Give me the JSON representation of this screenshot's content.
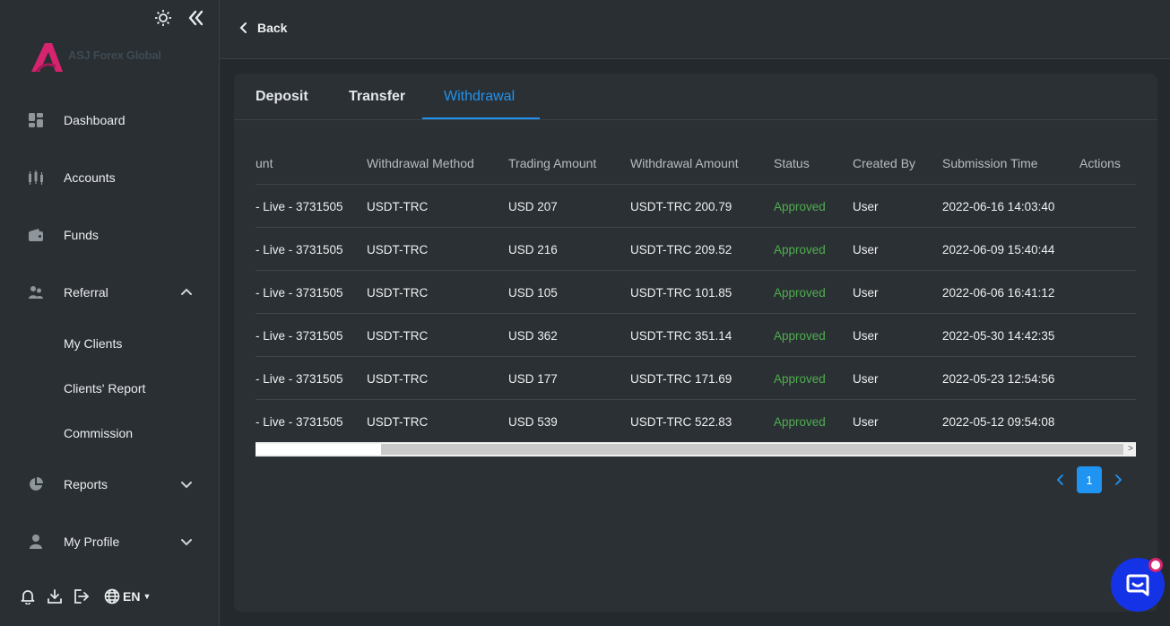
{
  "brand": {
    "name": "ASJ Forex Global",
    "accent": "#1f94f2",
    "logo_color": "#d6246e"
  },
  "sidebar": {
    "top_icons": [
      "sun-icon",
      "collapse-icon"
    ],
    "items": [
      {
        "label": "Dashboard",
        "icon": "dashboard-icon"
      },
      {
        "label": "Accounts",
        "icon": "accounts-icon"
      },
      {
        "label": "Funds",
        "icon": "wallet-icon"
      },
      {
        "label": "Referral",
        "icon": "users-icon",
        "expanded": true
      },
      {
        "label": "Reports",
        "icon": "pie-chart-icon",
        "expanded": false
      },
      {
        "label": "My Profile",
        "icon": "user-icon",
        "expanded": false
      }
    ],
    "referral_sub": [
      "My Clients",
      "Clients' Report",
      "Commission"
    ],
    "bottom_icons": [
      "bell-icon",
      "download-icon",
      "logout-icon",
      "globe-icon"
    ],
    "language": "EN"
  },
  "header": {
    "back_label": "Back"
  },
  "tabs": [
    {
      "label": "Deposit",
      "active": false
    },
    {
      "label": "Transfer",
      "active": false
    },
    {
      "label": "Withdrawal",
      "active": true
    }
  ],
  "table": {
    "columns": [
      "unt",
      "Withdrawal Method",
      "Trading Amount",
      "Withdrawal Amount",
      "Status",
      "Created By",
      "Submission Time",
      "Actions"
    ],
    "rows": [
      [
        "- Live - 3731505",
        "USDT-TRC",
        "USD 207",
        "USDT-TRC 200.79",
        "Approved",
        "User",
        "2022-06-16 14:03:40",
        ""
      ],
      [
        "- Live - 3731505",
        "USDT-TRC",
        "USD 216",
        "USDT-TRC 209.52",
        "Approved",
        "User",
        "2022-06-09 15:40:44",
        ""
      ],
      [
        "- Live - 3731505",
        "USDT-TRC",
        "USD 105",
        "USDT-TRC 101.85",
        "Approved",
        "User",
        "2022-06-06 16:41:12",
        ""
      ],
      [
        "- Live - 3731505",
        "USDT-TRC",
        "USD 362",
        "USDT-TRC 351.14",
        "Approved",
        "User",
        "2022-05-30 14:42:35",
        ""
      ],
      [
        "- Live - 3731505",
        "USDT-TRC",
        "USD 177",
        "USDT-TRC 171.69",
        "Approved",
        "User",
        "2022-05-23 12:54:56",
        ""
      ],
      [
        "- Live - 3731505",
        "USDT-TRC",
        "USD 539",
        "USDT-TRC 522.83",
        "Approved",
        "User",
        "2022-05-12 09:54:08",
        ""
      ]
    ]
  },
  "pagination": {
    "current_page": "1"
  },
  "chat": {
    "icon": "chat-icon"
  }
}
